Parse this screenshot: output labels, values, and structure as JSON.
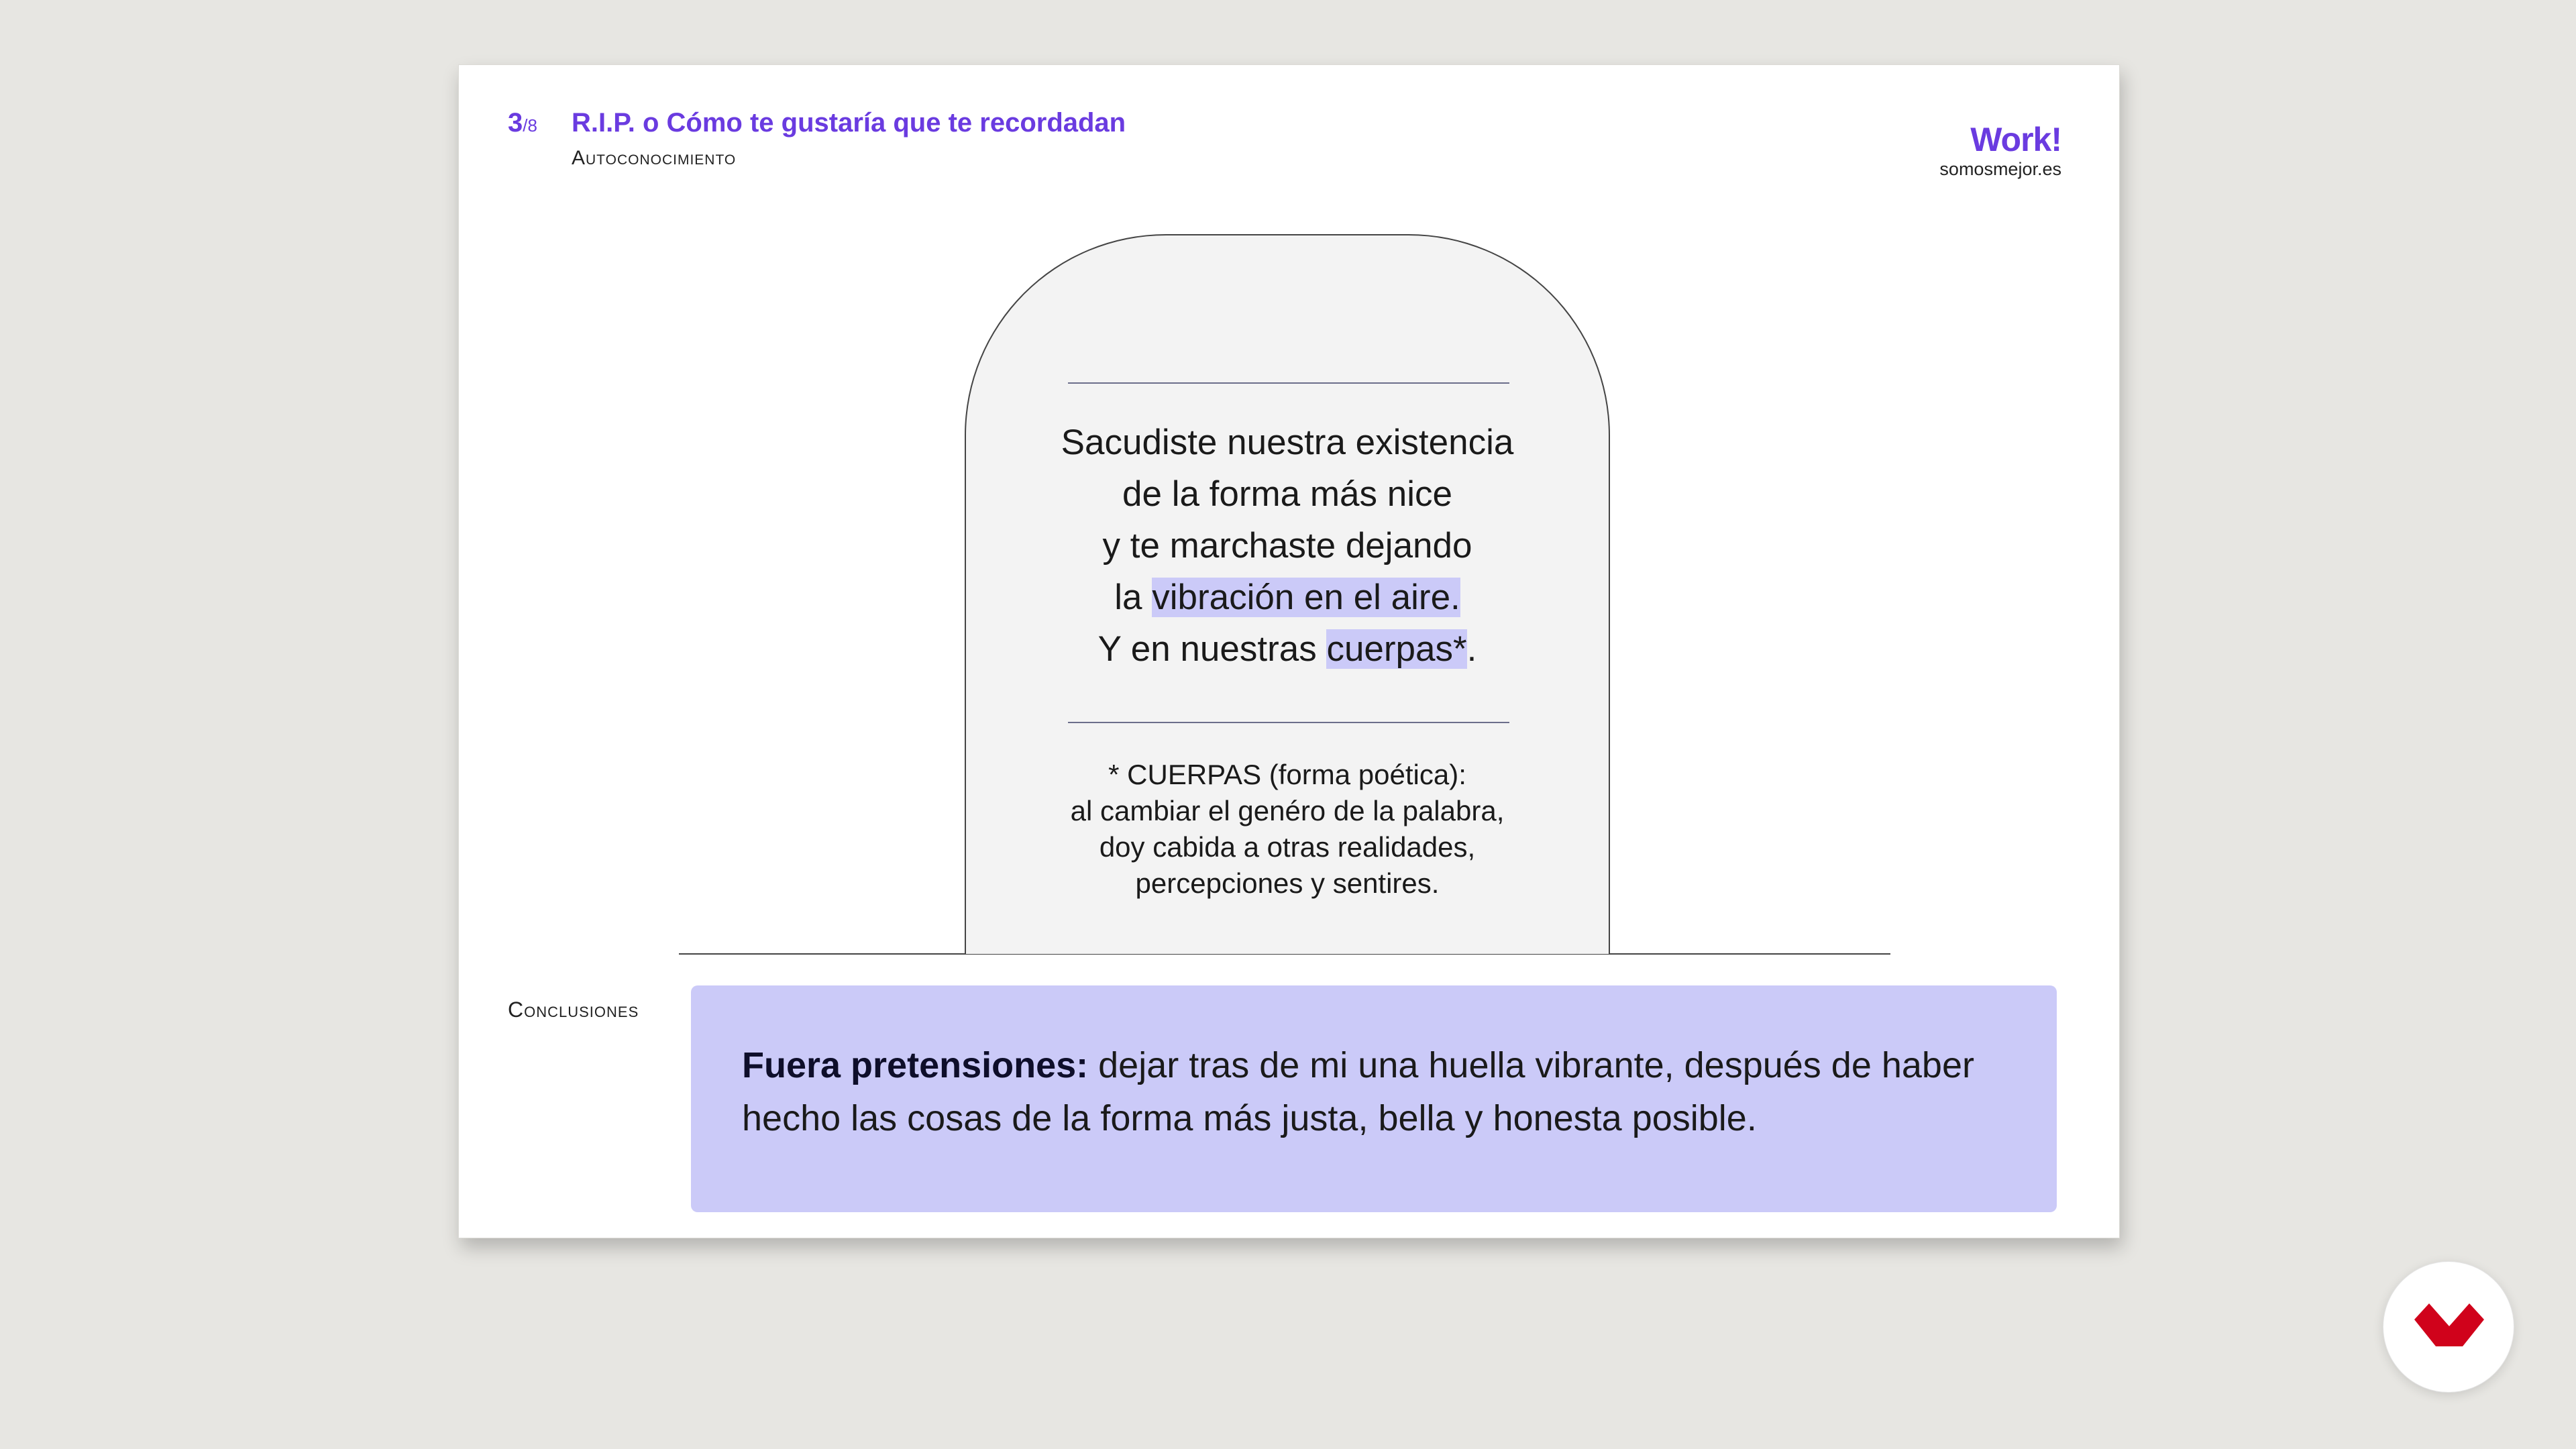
{
  "header": {
    "page_current": "3",
    "page_total": "/8",
    "title": "R.I.P. o Cómo te gustaría que te recordadan",
    "subtitle": "Autoconocimiento"
  },
  "brand": {
    "logo_text": "Work!",
    "url": "somosmejor.es",
    "accent_color": "#6a3be0"
  },
  "epitaph": {
    "line1": "Sacudiste nuestra existencia",
    "line2": "de la forma más nice",
    "line3": "y te marchaste dejando",
    "line4_prefix": "la ",
    "line4_highlight": "vibración en el aire.",
    "line5_prefix": "Y en nuestras ",
    "line5_highlight": "cuerpas*",
    "line5_suffix": "."
  },
  "footnote": {
    "line1": "* CUERPAS (forma poética):",
    "line2": "al cambiar el genéro de la palabra,",
    "line3": "doy cabida a otras realidades,",
    "line4": "percepciones y sentires."
  },
  "conclusions": {
    "label": "Conclusiones",
    "bold": "Fuera pretensiones:",
    "text": " dejar tras de mi una huella vibrante, después de haber hecho las cosas de la forma más justa, bella y honesta posible.",
    "highlight_color": "#cbcaf8"
  },
  "fab": {
    "icon": "brand-chevron-icon",
    "color": "#d0021b"
  }
}
